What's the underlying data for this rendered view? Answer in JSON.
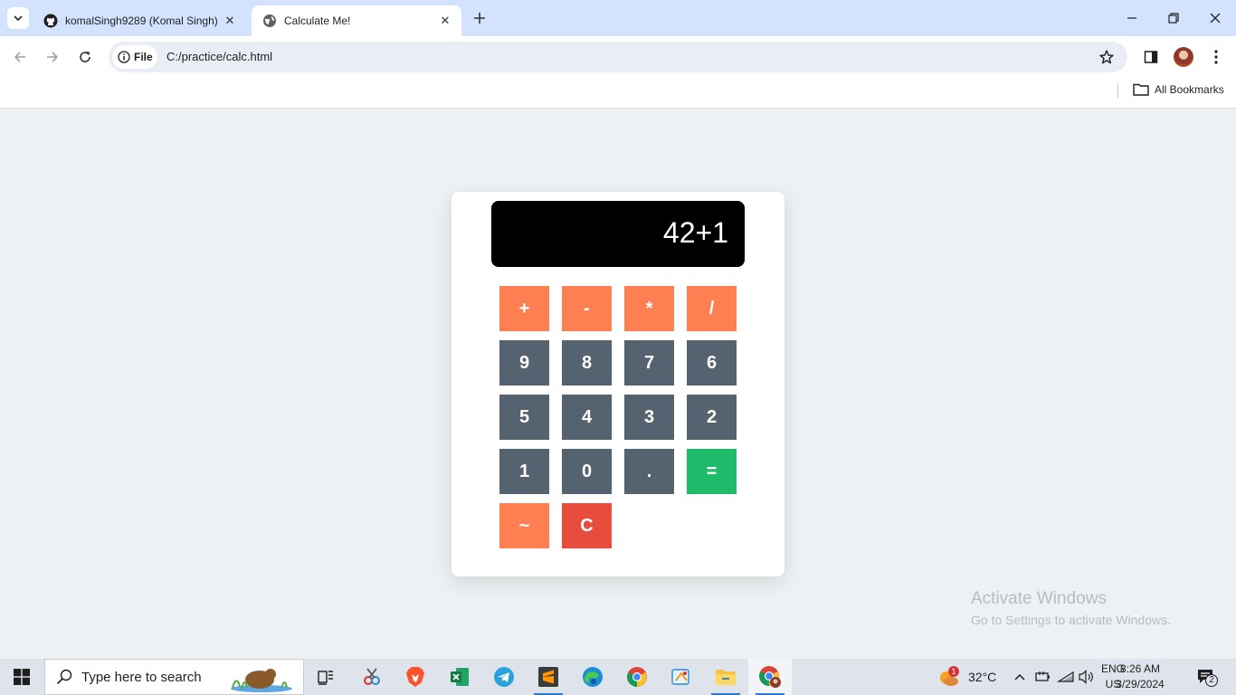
{
  "browser": {
    "tabs": [
      {
        "title": "komalSingh9289 (Komal Singh)",
        "active": false,
        "icon": "github-icon"
      },
      {
        "title": "Calculate Me!",
        "active": true,
        "icon": "globe-icon"
      }
    ],
    "site_chip": "File",
    "url": "C:/practice/calc.html",
    "bookmarks_label": "All Bookmarks"
  },
  "calculator": {
    "display": "42+1",
    "operators": [
      "+",
      "-",
      "*",
      "/"
    ],
    "row2": [
      "9",
      "8",
      "7",
      "6"
    ],
    "row3": [
      "5",
      "4",
      "3",
      "2"
    ],
    "row4": [
      "1",
      "0",
      ".",
      "="
    ],
    "row5": [
      "~",
      "C"
    ],
    "colors": {
      "operator": "#fe7f51",
      "number": "#556270",
      "equals": "#1fbb6b",
      "clear": "#e84c3d",
      "display": "#000000"
    }
  },
  "watermark": {
    "line1": "Activate Windows",
    "line2": "Go to Settings to activate Windows."
  },
  "taskbar": {
    "search_placeholder": "Type here to search",
    "weather": "32°C",
    "weather_badge": "1",
    "lang_top": "ENG",
    "lang_bottom": "US",
    "time": "8:26 AM",
    "date": "3/29/2024",
    "notifications": "2",
    "apps": [
      "task-view",
      "snipping-tool",
      "brave",
      "excel",
      "telegram",
      "sublime-text",
      "edge",
      "chrome",
      "paint",
      "file-explorer",
      "chrome-profile"
    ]
  }
}
